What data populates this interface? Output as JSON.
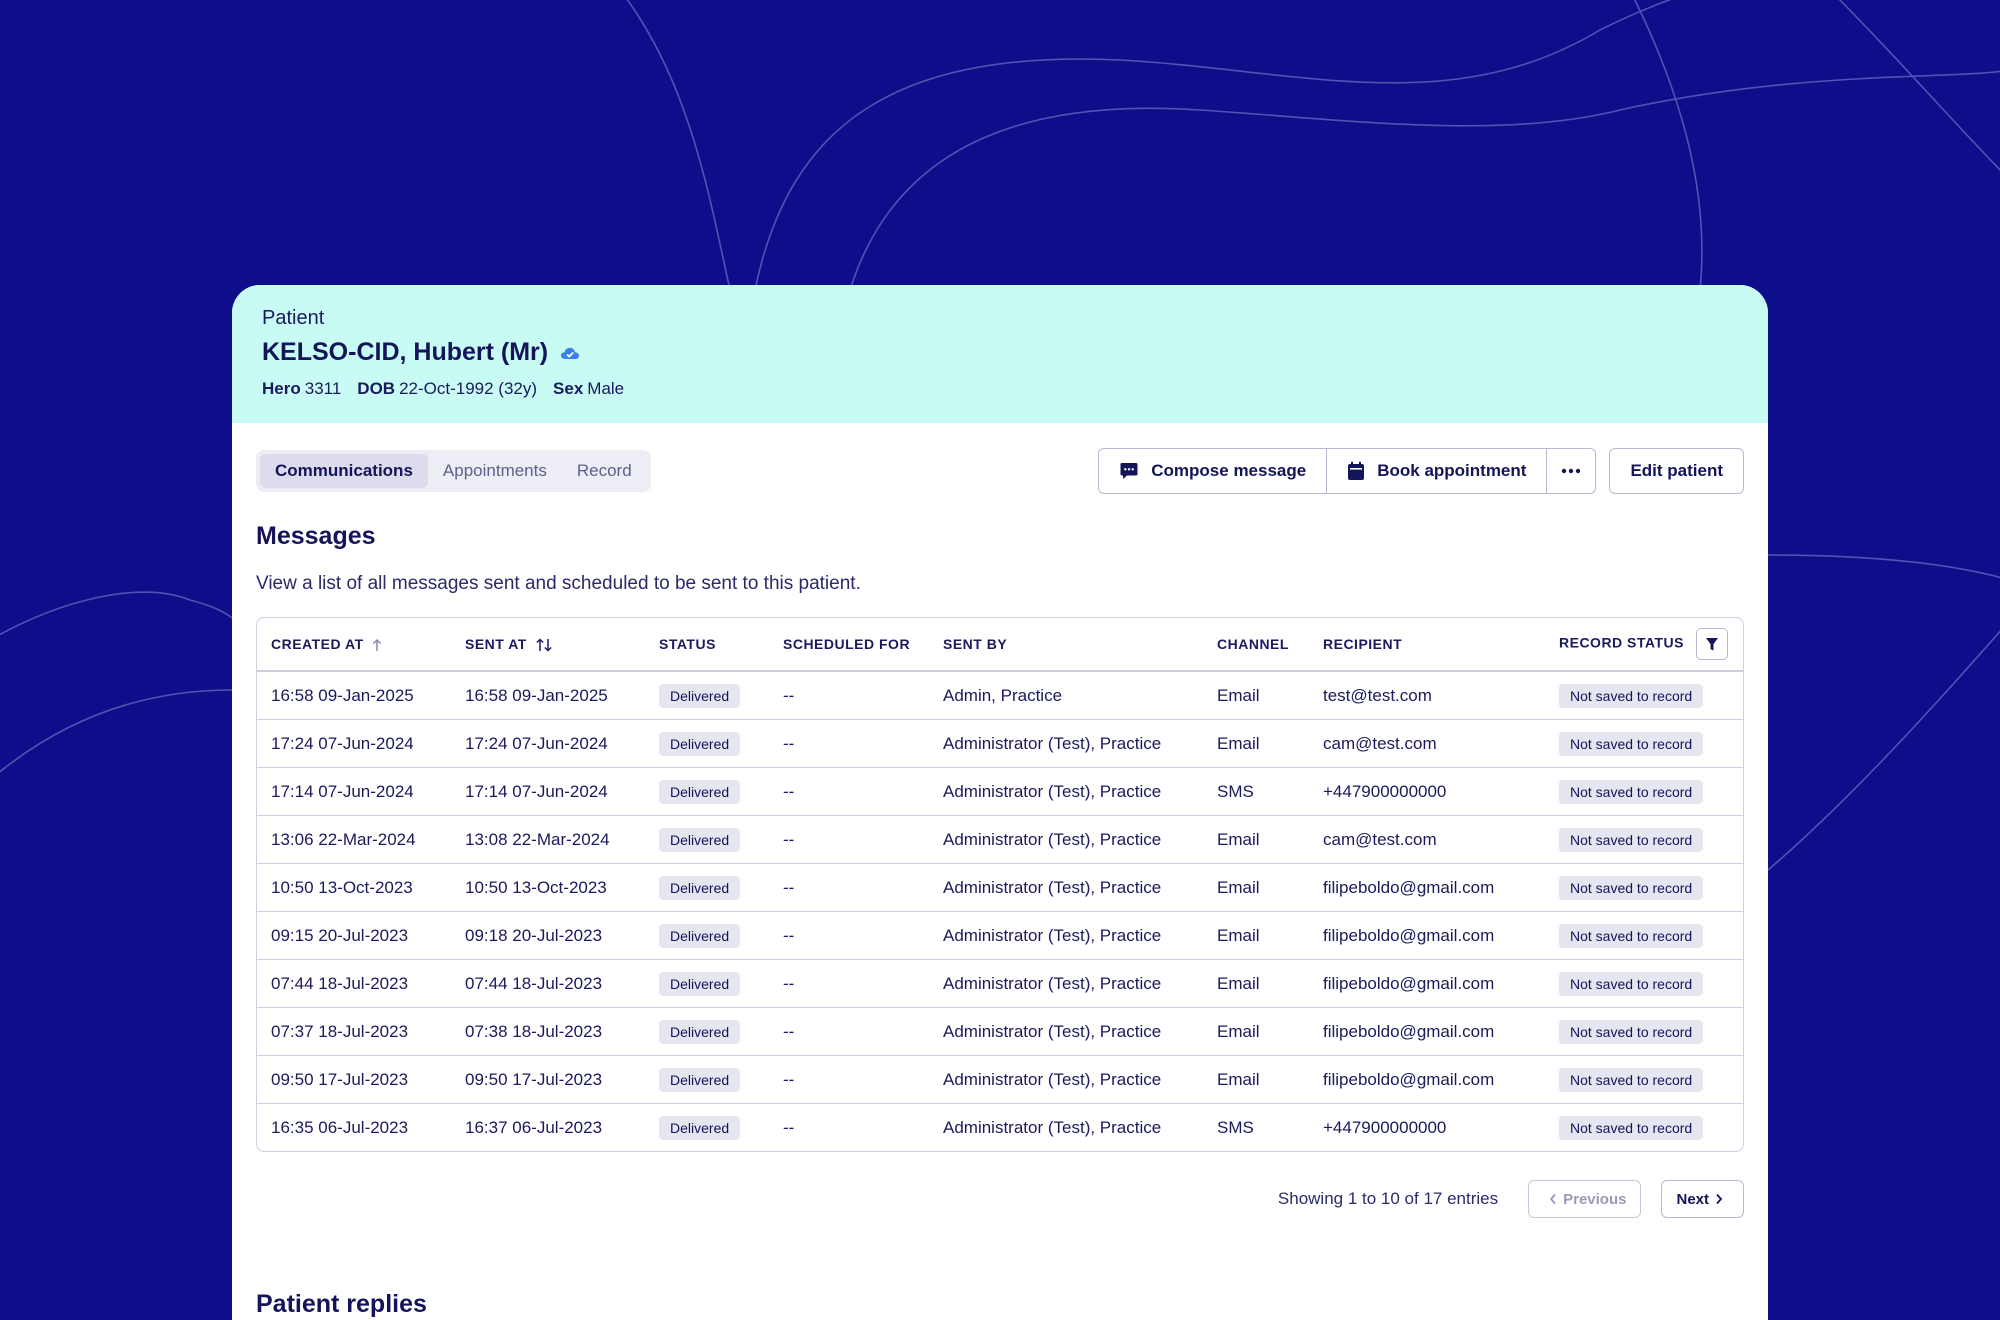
{
  "patient": {
    "label": "Patient",
    "name": "KELSO-CID, Hubert (Mr)",
    "meta": [
      {
        "key": "Hero",
        "value": "3311"
      },
      {
        "key": "DOB",
        "value": "22-Oct-1992 (32y)"
      },
      {
        "key": "Sex",
        "value": "Male"
      }
    ]
  },
  "tabs": [
    {
      "label": "Communications",
      "active": true
    },
    {
      "label": "Appointments",
      "active": false
    },
    {
      "label": "Record",
      "active": false
    }
  ],
  "actions": {
    "compose": "Compose message",
    "book": "Book appointment",
    "edit": "Edit patient"
  },
  "messages": {
    "title": "Messages",
    "description": "View a list of all messages sent and scheduled to be sent to this patient.",
    "columns": [
      "CREATED AT",
      "SENT AT",
      "STATUS",
      "SCHEDULED FOR",
      "SENT BY",
      "CHANNEL",
      "RECIPIENT",
      "RECORD STATUS"
    ],
    "rows": [
      [
        "16:58 09-Jan-2025",
        "16:58 09-Jan-2025",
        "Delivered",
        "--",
        "Admin, Practice",
        "Email",
        "test@test.com",
        "Not saved to record"
      ],
      [
        "17:24 07-Jun-2024",
        "17:24 07-Jun-2024",
        "Delivered",
        "--",
        "Administrator (Test), Practice",
        "Email",
        "cam@test.com",
        "Not saved to record"
      ],
      [
        "17:14 07-Jun-2024",
        "17:14 07-Jun-2024",
        "Delivered",
        "--",
        "Administrator (Test), Practice",
        "SMS",
        "+447900000000",
        "Not saved to record"
      ],
      [
        "13:06 22-Mar-2024",
        "13:08 22-Mar-2024",
        "Delivered",
        "--",
        "Administrator (Test), Practice",
        "Email",
        "cam@test.com",
        "Not saved to record"
      ],
      [
        "10:50 13-Oct-2023",
        "10:50 13-Oct-2023",
        "Delivered",
        "--",
        "Administrator (Test), Practice",
        "Email",
        "filipeboldo@gmail.com",
        "Not saved to record"
      ],
      [
        "09:15 20-Jul-2023",
        "09:18 20-Jul-2023",
        "Delivered",
        "--",
        "Administrator (Test), Practice",
        "Email",
        "filipeboldo@gmail.com",
        "Not saved to record"
      ],
      [
        "07:44 18-Jul-2023",
        "07:44 18-Jul-2023",
        "Delivered",
        "--",
        "Administrator (Test), Practice",
        "Email",
        "filipeboldo@gmail.com",
        "Not saved to record"
      ],
      [
        "07:37 18-Jul-2023",
        "07:38 18-Jul-2023",
        "Delivered",
        "--",
        "Administrator (Test), Practice",
        "Email",
        "filipeboldo@gmail.com",
        "Not saved to record"
      ],
      [
        "09:50 17-Jul-2023",
        "09:50 17-Jul-2023",
        "Delivered",
        "--",
        "Administrator (Test), Practice",
        "Email",
        "filipeboldo@gmail.com",
        "Not saved to record"
      ],
      [
        "16:35 06-Jul-2023",
        "16:37 06-Jul-2023",
        "Delivered",
        "--",
        "Administrator (Test), Practice",
        "SMS",
        "+447900000000",
        "Not saved to record"
      ]
    ]
  },
  "pagination": {
    "summary": "Showing 1 to 10 of 17 entries",
    "previous": "Previous",
    "next": "Next"
  },
  "replies": {
    "title": "Patient replies"
  },
  "icons": {
    "verified": "cloud-check-icon",
    "compose": "chat-bubble-icon",
    "book": "calendar-icon",
    "more": "ellipsis-icon",
    "filter": "filter-icon",
    "sort_asc": "arrow-up-icon",
    "sort_both": "sort-arrows-icon"
  },
  "colors": {
    "background": "#0e0e8a",
    "header": "#c8fbf3",
    "text": "#14145a",
    "accent": "#3d7ff0"
  }
}
